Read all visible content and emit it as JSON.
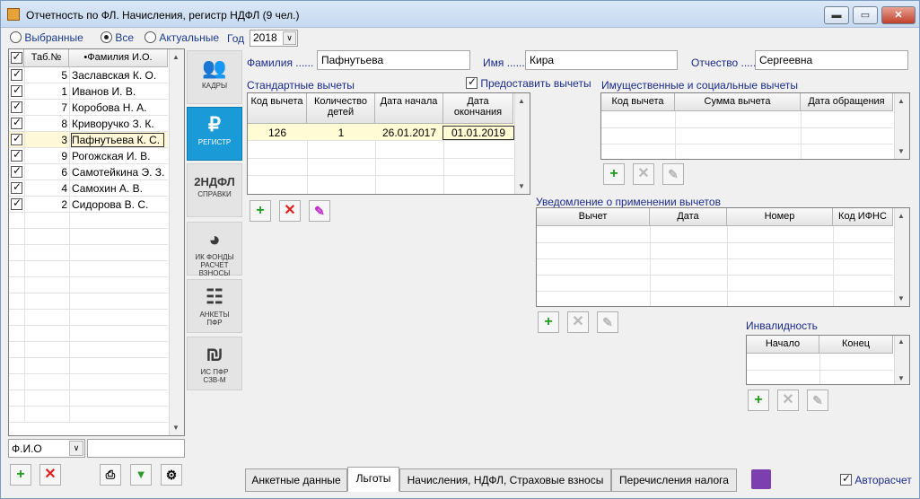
{
  "window": {
    "title": "Отчетность по ФЛ. Начисления, регистр НДФЛ (9 чел.)",
    "min": "▬",
    "max": "▭",
    "close": "✕"
  },
  "filter": {
    "opt1": "Выбранные",
    "opt2": "Все",
    "opt3": "Актуальные",
    "selected": "Все",
    "year_label": "Год",
    "year": "2018"
  },
  "list": {
    "headers": [
      "Таб.№",
      "•Фамилия И.О."
    ],
    "rows": [
      {
        "n": "5",
        "name": "Заславская К. О.",
        "checked": true
      },
      {
        "n": "1",
        "name": "Иванов И. В.",
        "checked": true
      },
      {
        "n": "7",
        "name": "Коробова Н. А.",
        "checked": true
      },
      {
        "n": "8",
        "name": "Криворучко З. К.",
        "checked": true
      },
      {
        "n": "3",
        "name": "Пафнутьева К. С.",
        "checked": true,
        "selected": true
      },
      {
        "n": "9",
        "name": "Рогожская И. В.",
        "checked": true
      },
      {
        "n": "6",
        "name": "Самотейкина Э. З.",
        "checked": true
      },
      {
        "n": "4",
        "name": "Самохин А. В.",
        "checked": true
      },
      {
        "n": "2",
        "name": "Сидорова В. С.",
        "checked": true
      }
    ],
    "search_field": "Ф.И.О"
  },
  "side": [
    {
      "icon": "users-icon",
      "glyph": "👥",
      "label": "КАДРЫ"
    },
    {
      "icon": "ruble-icon",
      "glyph": "₽",
      "label": "РЕГИСТР",
      "active": true
    },
    {
      "icon": "ndfl-icon",
      "glyph": "2НДФЛ",
      "label": "СПРАВКИ"
    },
    {
      "icon": "pie-chart-icon",
      "glyph": "◕",
      "label": "ИК ФОНДЫ\nРАСЧЕТ ВЗНОСЫ"
    },
    {
      "icon": "form-icon",
      "glyph": "☷",
      "label": "АНКЕТЫ\nПФР"
    },
    {
      "icon": "pfr-icon",
      "glyph": "₪",
      "label": "ИС ПФР\nСЗВ-М"
    }
  ],
  "person": {
    "last_label": "Фамилия ......",
    "last": "Пафнутьева",
    "first_label": "Имя ......",
    "first": "Кира",
    "middle_label": "Отчество ......",
    "middle": "Сергеевна"
  },
  "std": {
    "title": "Стандартные вычеты",
    "provide_label": "Предоставить вычеты",
    "headers": [
      "Код вычета",
      "Количество детей",
      "Дата начала",
      "Дата окончания"
    ],
    "rows": [
      [
        "126",
        "1",
        "26.01.2017",
        "01.01.2019"
      ]
    ]
  },
  "prop": {
    "title": "Имущественные и социальные вычеты",
    "headers": [
      "Код вычета",
      "Сумма вычета",
      "Дата обращения"
    ]
  },
  "notice": {
    "title": "Уведомление о применении вычетов",
    "headers": [
      "Вычет",
      "Дата",
      "Номер",
      "Код ИФНС"
    ]
  },
  "disab": {
    "title": "Инвалидность",
    "headers": [
      "Начало",
      "Конец"
    ]
  },
  "tabs": [
    "Анкетные данные",
    "Льготы",
    "Начисления, НДФЛ, Страховые взносы",
    "Перечисления налога"
  ],
  "selected_tab": "Льготы",
  "autocalc": "Авторасчет",
  "colors": {
    "accent": "#1a9ad6",
    "label": "#1a2a8a"
  }
}
